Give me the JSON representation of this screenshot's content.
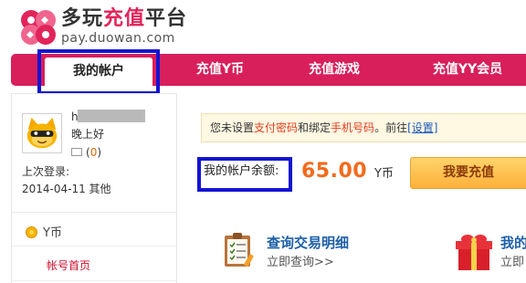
{
  "logo": {
    "title_part1": "多玩",
    "title_part2": "充值",
    "title_part3": "平台",
    "domain": "pay.duowan.com"
  },
  "nav": {
    "tabs": [
      {
        "label": "我的帐户",
        "active": true
      },
      {
        "label": "充值Y币",
        "active": false
      },
      {
        "label": "充值游戏",
        "active": false
      },
      {
        "label": "充值YY会员",
        "active": false
      }
    ]
  },
  "sidebar": {
    "username": "h",
    "greeting": "晚上好",
    "mail_open": "(",
    "mail_count": "0",
    "mail_close": ")",
    "last_login_label": "上次登录:",
    "last_login_value": "2014-04-11 其他",
    "coin_label": "Y币",
    "menu_item": "帐号首页"
  },
  "notice": {
    "text1": "您未设置",
    "link_payment_password": "支付密码",
    "text2": "和绑定",
    "link_phone": "手机号码",
    "text3": "。前往",
    "link_settings": "[设置]"
  },
  "balance": {
    "label": "我的帐户余额:",
    "amount": "65.00",
    "unit": "Y币",
    "recharge_button": "我要充值"
  },
  "quick_links": [
    {
      "title": "查询交易明细",
      "subtitle": "立即查询>>"
    },
    {
      "title": "我的",
      "subtitle": "立即"
    }
  ],
  "colors": {
    "nav_bg": "#d81e5b",
    "brand_red": "#e1245a",
    "amount_orange": "#f26a1b",
    "highlight_blue": "#1414d2",
    "link_blue": "#1d5fa8"
  },
  "icons": {
    "logo": "duowan-logo-icon",
    "avatar": "yy-cat-avatar",
    "mail": "mail-icon",
    "coin": "y-coin-icon",
    "quick_link_1": "clipboard-icon",
    "quick_link_2": "gift-icon"
  }
}
